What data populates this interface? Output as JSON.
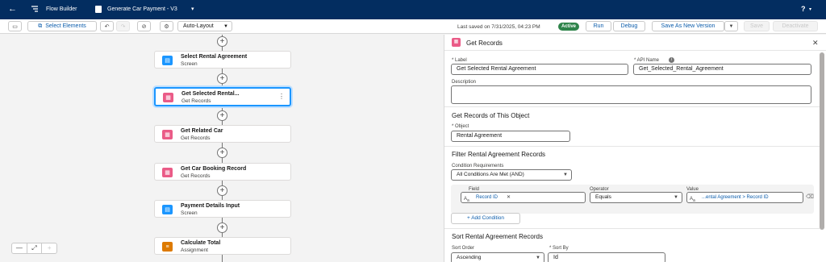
{
  "header": {
    "app_name": "Flow Builder",
    "flow_name": "Generate Car Payment - V3",
    "help": "?"
  },
  "toolbar": {
    "select_elements": "Select Elements",
    "layout": "Auto-Layout",
    "last_saved": "Last saved on 7/31/2025, 04:23 PM",
    "status": "Active",
    "run": "Run",
    "debug": "Debug",
    "save_as": "Save As New Version",
    "save": "Save",
    "deactivate": "Deactivate"
  },
  "canvas": {
    "nodes": [
      {
        "title": "Select Rental Agreement",
        "subtitle": "Screen",
        "kind": "screen"
      },
      {
        "title": "Get Selected Rental...",
        "subtitle": "Get Records",
        "kind": "records"
      },
      {
        "title": "Get Related Car",
        "subtitle": "Get Records",
        "kind": "records"
      },
      {
        "title": "Get Car Booking Record",
        "subtitle": "Get Records",
        "kind": "records"
      },
      {
        "title": "Payment Details Input",
        "subtitle": "Screen",
        "kind": "screen"
      },
      {
        "title": "Calculate Total",
        "subtitle": "Assignment",
        "kind": "assignment"
      }
    ],
    "zoom": {
      "minus": "—",
      "fit": "⤢",
      "plus": "+"
    }
  },
  "panel": {
    "title": "Get Records",
    "label_label": "* Label",
    "label_value": "Get Selected Rental Agreement",
    "api_label": "* API Name",
    "api_value": "Get_Selected_Rental_Agreement",
    "description_label": "Description",
    "object_section": "Get Records of This Object",
    "object_label": "* Object",
    "object_value": "Rental Agreement",
    "filter_section": "Filter Rental Agreement Records",
    "condition_req_label": "Condition Requirements",
    "condition_req_value": "All Conditions Are Met (AND)",
    "field_label": "Field",
    "field_value": "Record ID",
    "operator_label": "Operator",
    "operator_value": "Equals",
    "value_label": "Value",
    "value_value": "...ental Agreement > Record ID",
    "add_condition": "Add Condition",
    "sort_section": "Sort Rental Agreement Records",
    "sort_order_label": "Sort Order",
    "sort_order_value": "Ascending",
    "sort_by_label": "* Sort By",
    "sort_by_value": "Id"
  },
  "colors": {
    "header_bg": "#032d60",
    "active": "#2e844a",
    "record_icon": "#ea5b87",
    "screen_icon": "#1b96ff",
    "assignment_icon": "#dd7a01",
    "selection": "#1b96ff"
  }
}
